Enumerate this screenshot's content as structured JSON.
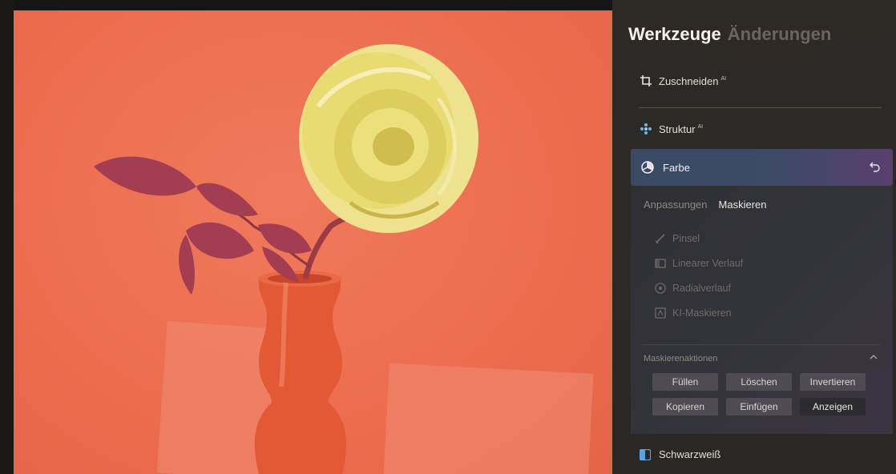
{
  "panel": {
    "tabs": [
      {
        "label": "Werkzeuge",
        "active": true
      },
      {
        "label": "Änderungen",
        "active": false
      }
    ],
    "sections": {
      "crop": {
        "label": "Zuschneiden",
        "ai_badge": "AI",
        "icon": "crop-icon"
      },
      "structure": {
        "label": "Struktur",
        "ai_badge": "AI",
        "icon": "structure-icon"
      },
      "color": {
        "label": "Farbe",
        "icon": "color-wheel-icon",
        "undo_icon": "undo-icon"
      },
      "bw": {
        "label": "Schwarzweiß",
        "icon": "black-white-icon"
      }
    },
    "color_subtabs": [
      {
        "label": "Anpassungen",
        "active": false
      },
      {
        "label": "Maskieren",
        "active": true
      }
    ],
    "mask_tools": [
      {
        "label": "Pinsel",
        "icon": "brush-icon"
      },
      {
        "label": "Linearer Verlauf",
        "icon": "linear-gradient-icon"
      },
      {
        "label": "Radialverlauf",
        "icon": "radial-gradient-icon"
      },
      {
        "label": "KI-Maskieren",
        "icon": "ai-mask-icon"
      }
    ],
    "mask_actions": {
      "title": "Maskierenaktionen",
      "buttons": [
        "Füllen",
        "Löschen",
        "Invertieren",
        "Kopieren",
        "Einfügen",
        "Anzeigen"
      ]
    }
  },
  "colors": {
    "accent_gradient_start": "#3a4a63",
    "accent_gradient_end": "#5a3f6e",
    "mask_overlay": "#ec6c4e",
    "rose": "#e7df7a"
  }
}
